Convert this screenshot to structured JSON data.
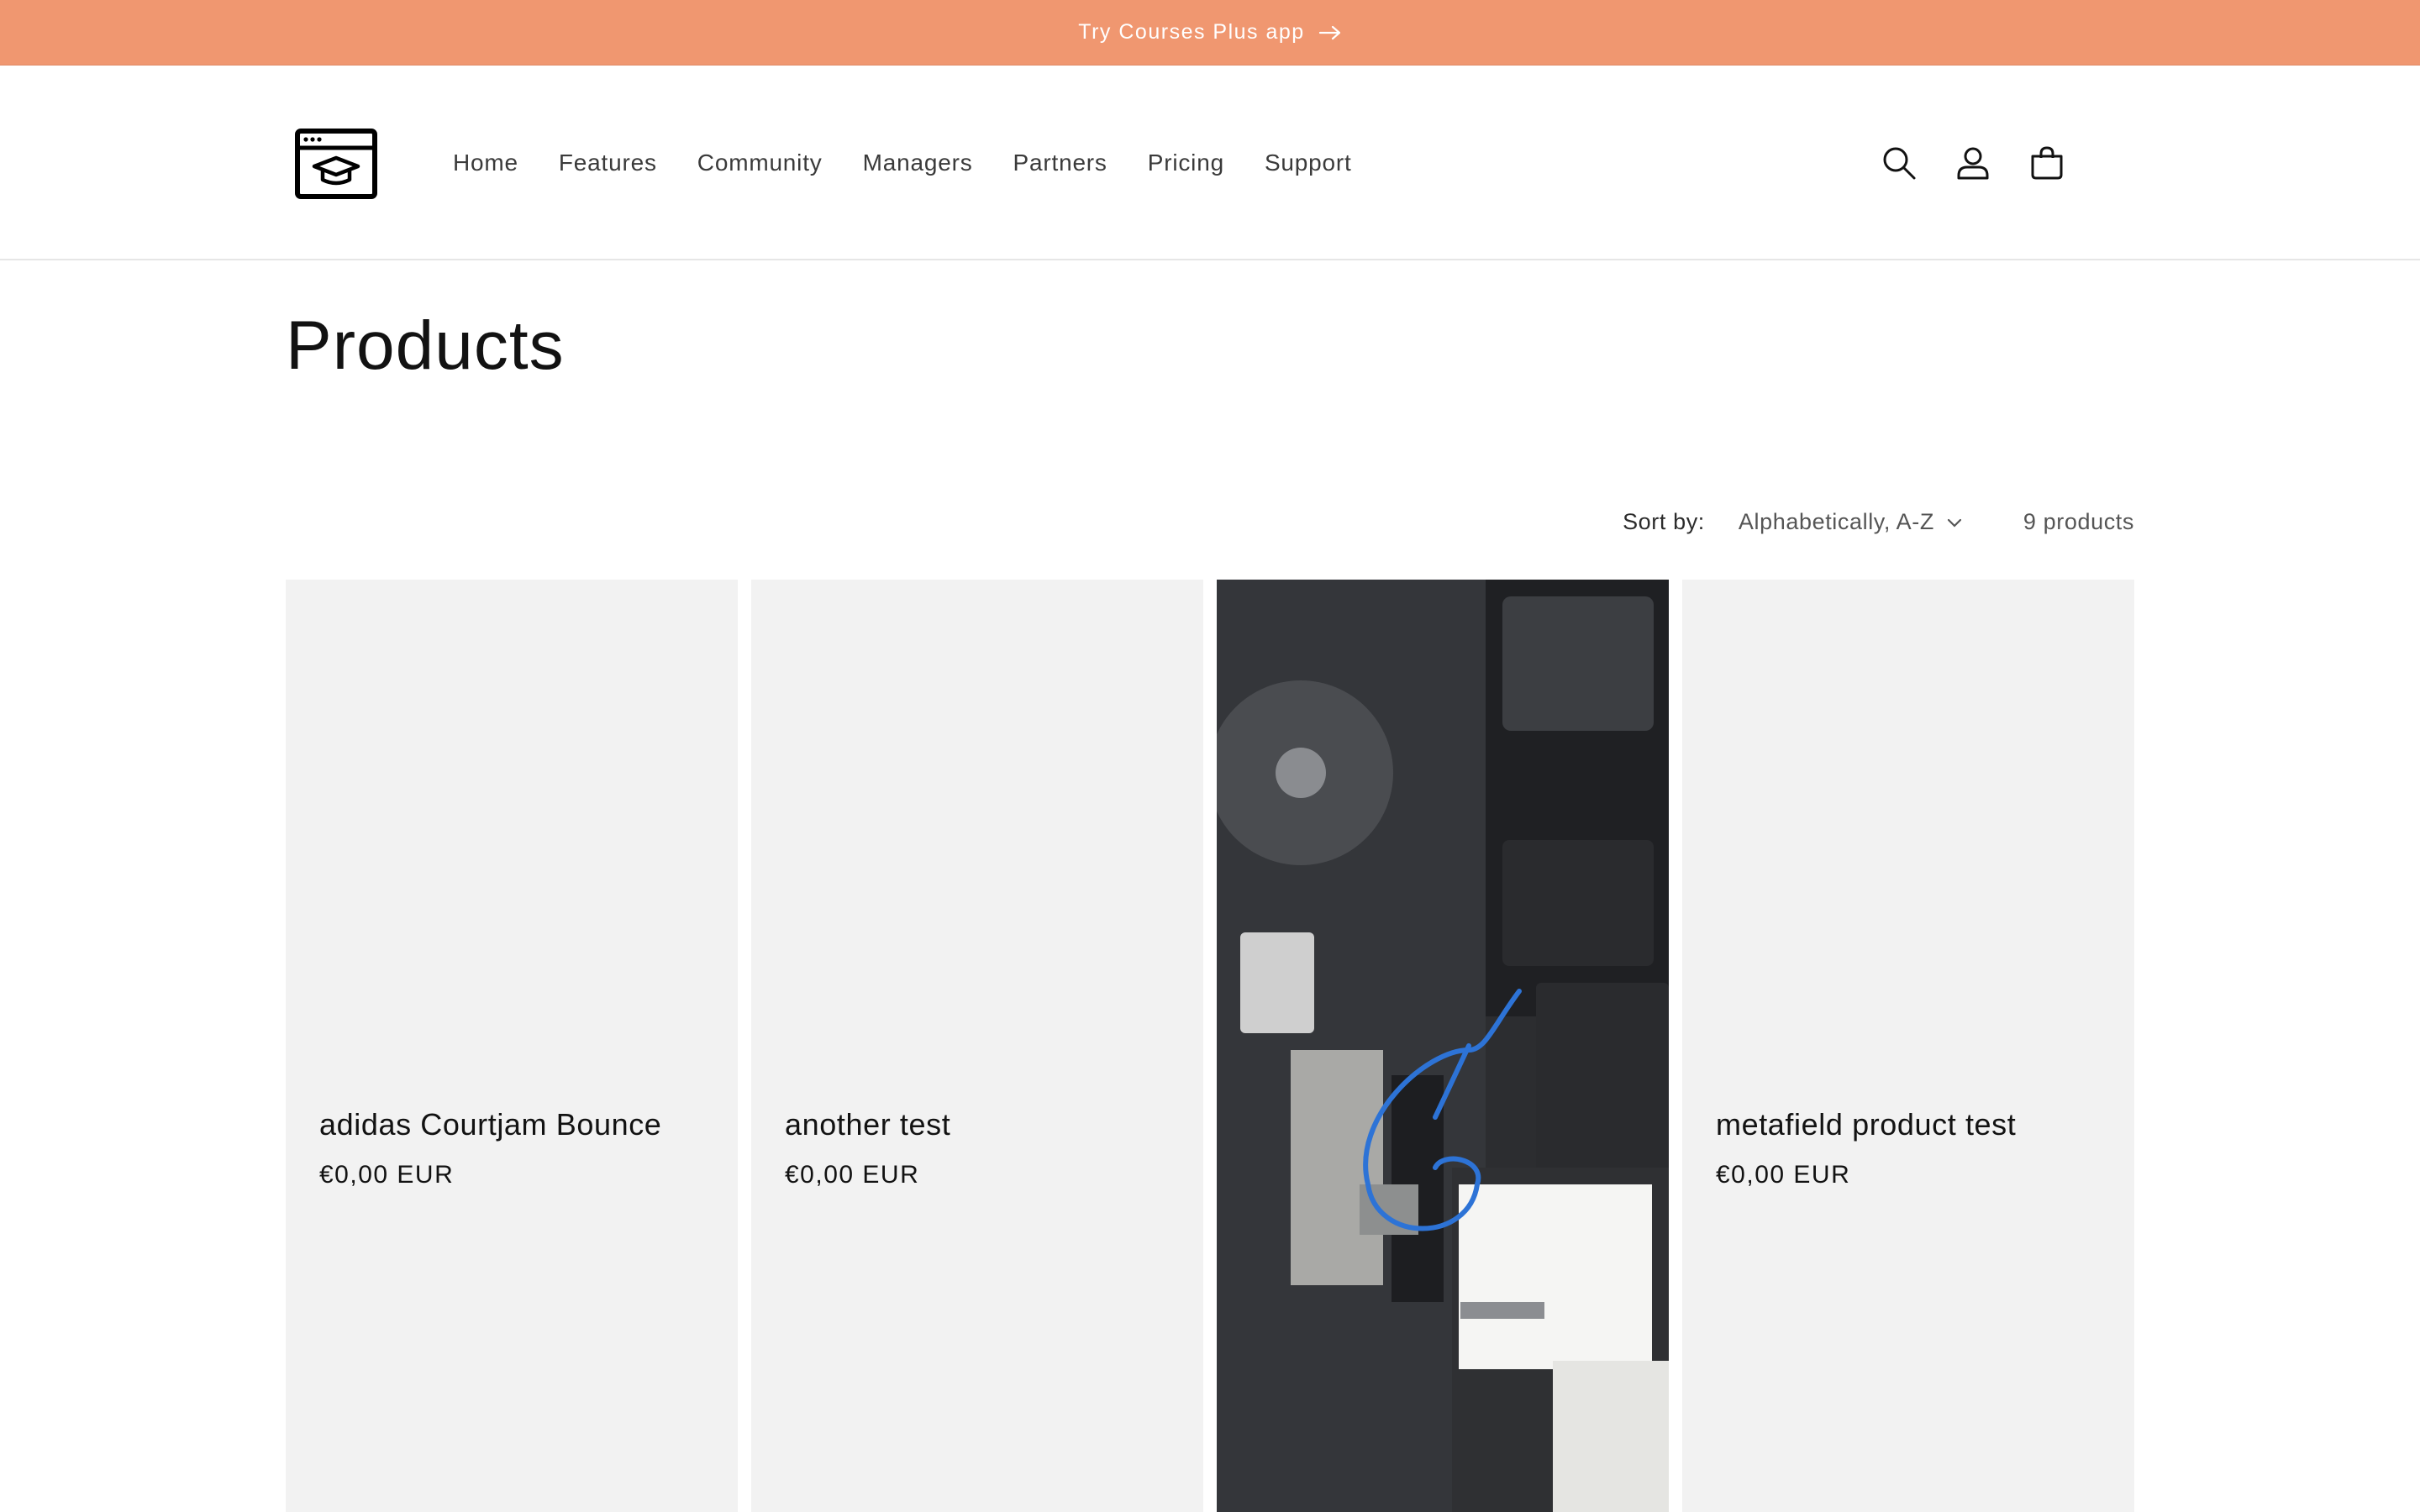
{
  "announcement": {
    "text": "Try Courses Plus app"
  },
  "header": {
    "nav": [
      "Home",
      "Features",
      "Community",
      "Managers",
      "Partners",
      "Pricing",
      "Support"
    ]
  },
  "main": {
    "title": "Products",
    "sort_label": "Sort by:",
    "sort_value": "Alphabetically, A-Z",
    "product_count": "9 products"
  },
  "products": [
    {
      "title": "adidas Courtjam Bounce",
      "price": "€0,00 EUR"
    },
    {
      "title": "another test",
      "price": "€0,00 EUR"
    },
    {
      "title": "",
      "price": ""
    },
    {
      "title": "metafield product test",
      "price": "€0,00 EUR"
    }
  ],
  "colors": {
    "announcement_bg": "#f09770",
    "card_bg": "#f2f2f2"
  },
  "icons": [
    "arrow-right-icon",
    "logo-icon",
    "search-icon",
    "account-icon",
    "cart-icon",
    "chevron-down-icon"
  ]
}
